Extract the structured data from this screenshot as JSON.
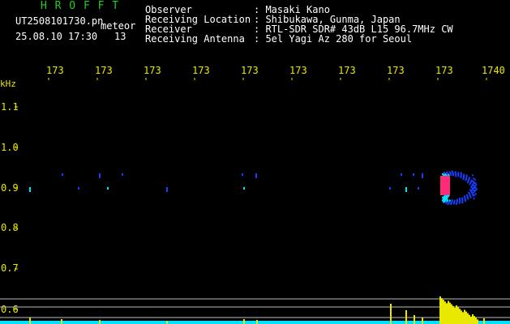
{
  "app": {
    "title": "H R O F F T",
    "filename": "UT2508101730.pn",
    "detection_label": "meteor",
    "datetime": "25.08.10 17:30",
    "count": "13"
  },
  "info": {
    "labels": [
      "Observer",
      "Receiving Location",
      "Receiver",
      "Receiving Antenna"
    ],
    "values": [
      ": Masaki Kano",
      ": Shibukawa, Gunma, Japan",
      ": RTL-SDR SDR# 43dB L15 96.7MHz CW",
      ": 5el Yagi Az 280 for Seoul"
    ]
  },
  "time_axis": {
    "labels": [
      "173",
      "173",
      "173",
      "173",
      "173",
      "173",
      "173",
      "173",
      "173",
      "1740"
    ]
  },
  "freq_axis": {
    "unit": "kHz",
    "labels": [
      "1.1",
      "1.0",
      "0.9",
      "0.8",
      "0.7",
      "0.6"
    ]
  },
  "colors": {
    "background": "#000000",
    "title": "#22cc22",
    "text": "#ffffff",
    "axis": "#e8e800",
    "signal_low": "#1a3cff",
    "signal_mid": "#00e0ff",
    "signal_high": "#ff2a7a",
    "level_bars": "#e8e800",
    "level_baseline": "#00e0ff"
  },
  "spectrogram": {
    "carrier_band": "0.9 kHz",
    "meteor_echo": "strong echo near 17:39"
  }
}
